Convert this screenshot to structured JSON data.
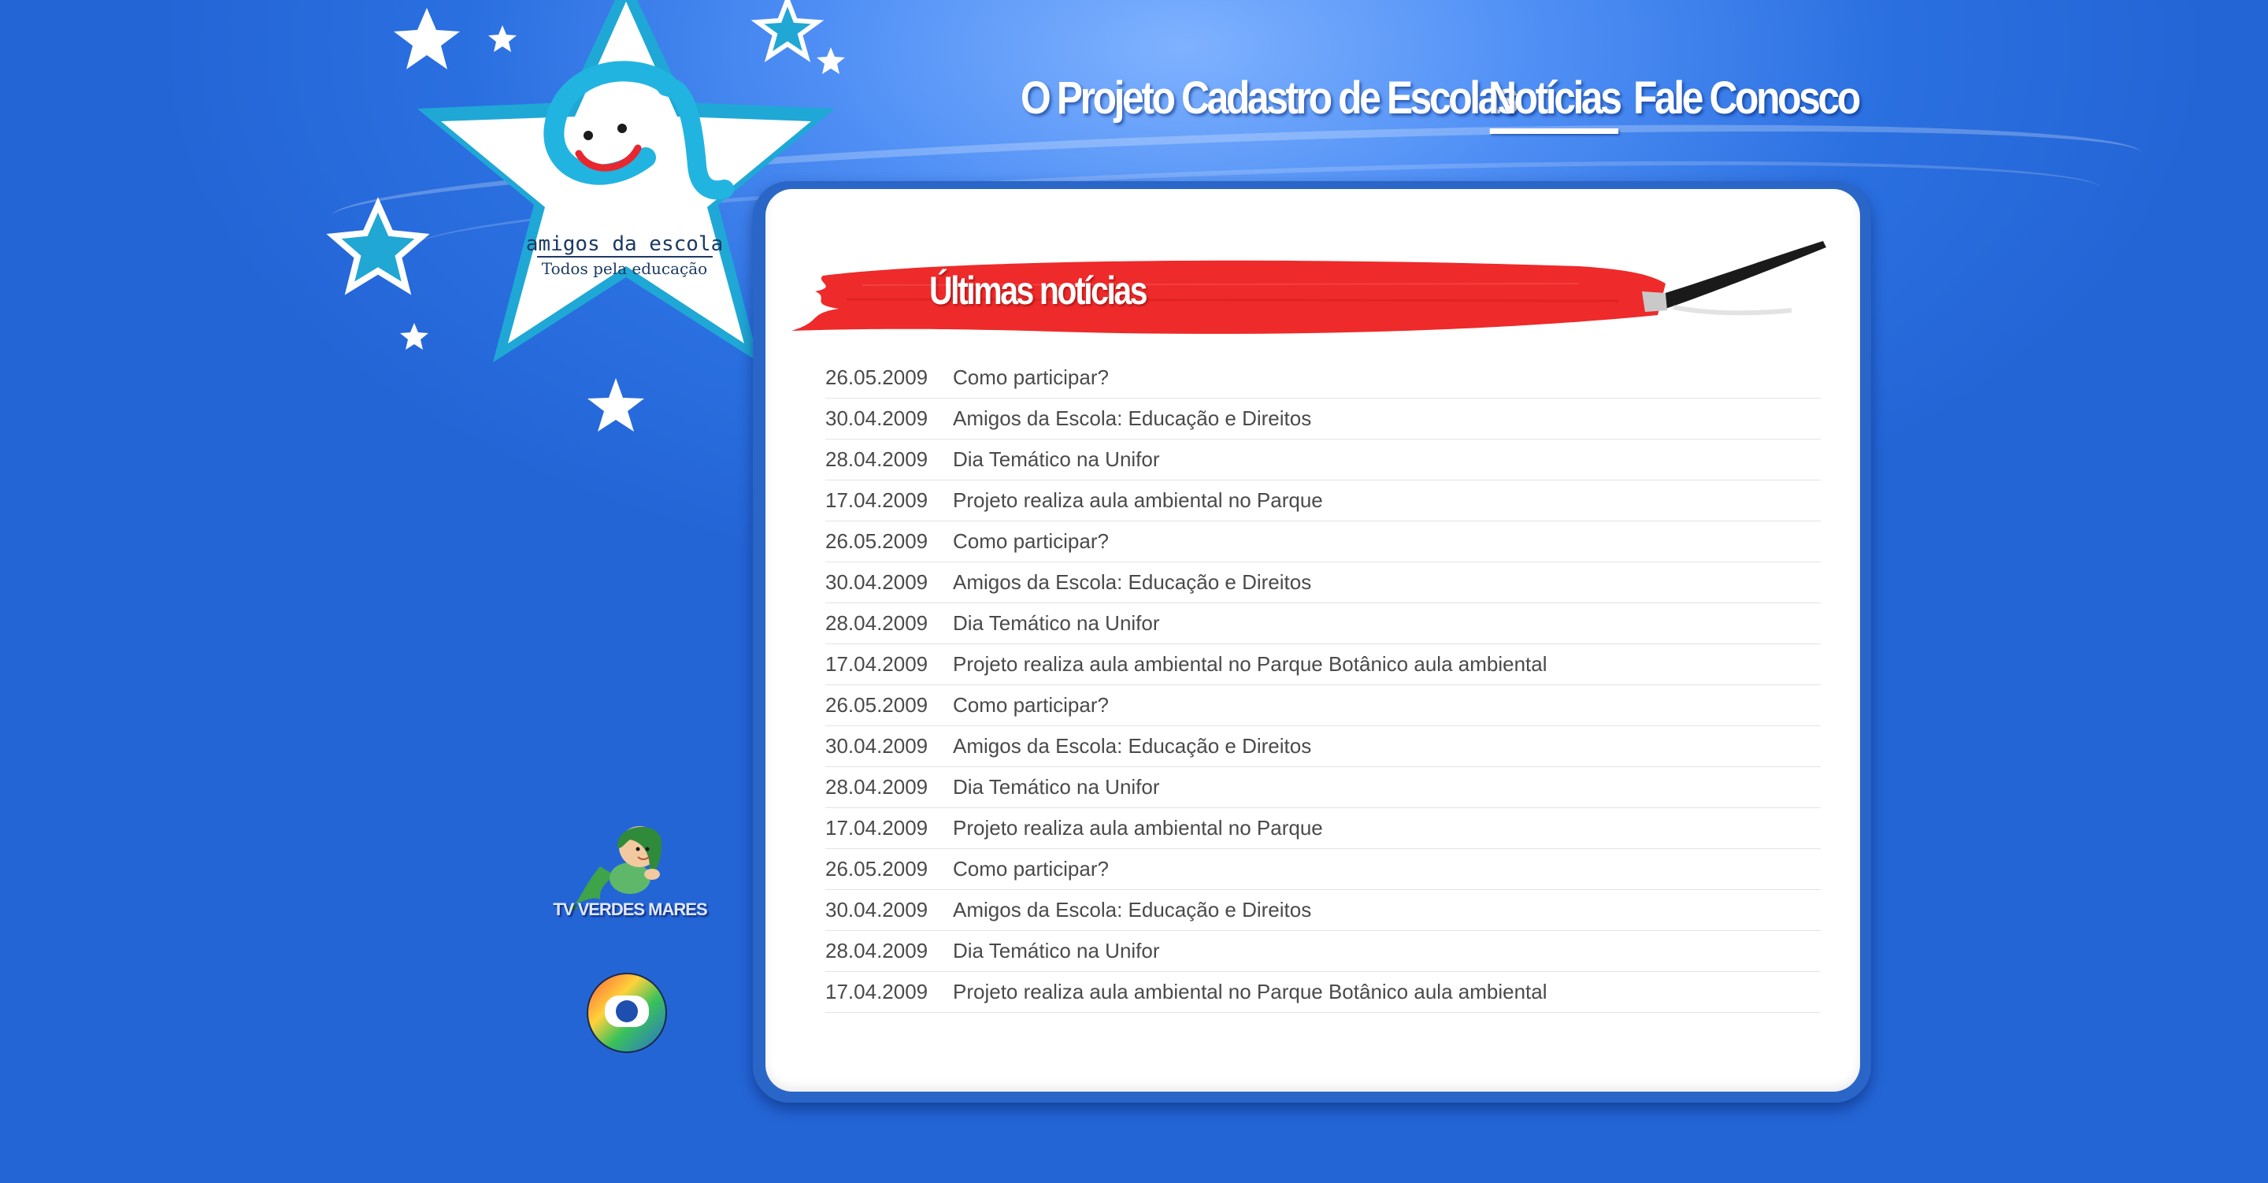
{
  "brand": {
    "logo_line1": "amigos da escola",
    "logo_line2": "Todos pela educação"
  },
  "nav": {
    "items": [
      {
        "label": "O Projeto",
        "active": false
      },
      {
        "label": "Cadastro de Escolas",
        "active": false
      },
      {
        "label": "Notícias",
        "active": true
      },
      {
        "label": "Fale Conosco",
        "active": false
      }
    ]
  },
  "main": {
    "section_title": "Últimas notícias",
    "news": [
      {
        "date": "26.05.2009",
        "title": "Como participar?"
      },
      {
        "date": "30.04.2009",
        "title": "Amigos da Escola: Educação e Direitos"
      },
      {
        "date": "28.04.2009",
        "title": "Dia Temático na Unifor"
      },
      {
        "date": "17.04.2009",
        "title": "Projeto realiza aula ambiental no Parque"
      },
      {
        "date": "26.05.2009",
        "title": "Como participar?"
      },
      {
        "date": "30.04.2009",
        "title": "Amigos da Escola: Educação e Direitos"
      },
      {
        "date": "28.04.2009",
        "title": "Dia Temático na Unifor"
      },
      {
        "date": "17.04.2009",
        "title": "Projeto realiza aula ambiental no Parque Botânico aula ambiental"
      },
      {
        "date": "26.05.2009",
        "title": "Como participar?"
      },
      {
        "date": "30.04.2009",
        "title": "Amigos da Escola: Educação e Direitos"
      },
      {
        "date": "28.04.2009",
        "title": "Dia Temático na Unifor"
      },
      {
        "date": "17.04.2009",
        "title": "Projeto realiza aula ambiental no Parque"
      },
      {
        "date": "26.05.2009",
        "title": "Como participar?"
      },
      {
        "date": "30.04.2009",
        "title": "Amigos da Escola: Educação e Direitos"
      },
      {
        "date": "28.04.2009",
        "title": "Dia Temático na Unifor"
      },
      {
        "date": "17.04.2009",
        "title": "Projeto realiza aula ambiental no Parque Botânico aula ambiental"
      }
    ]
  },
  "sponsors": {
    "tvvm_label": "TV VERDES MARES",
    "tvvm_icon": "mermaid-logo-icon",
    "globo_icon": "globo-logo-icon"
  },
  "colors": {
    "background": "#2a6fe0",
    "star_border": "#1fa8d6",
    "brush_red": "#ee2a2a",
    "text": "#4a4a4a"
  }
}
